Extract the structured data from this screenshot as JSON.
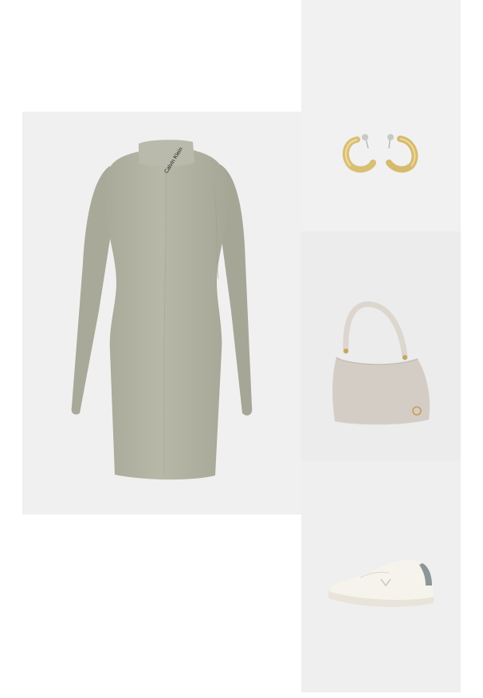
{
  "outfit": {
    "items": [
      {
        "id": "dress",
        "brand_print": "Calvin Klein",
        "color": "#b2b3a3"
      },
      {
        "id": "earrings",
        "color": "#d8bd74"
      },
      {
        "id": "shoulder-bag",
        "color": "#d3cdc6"
      },
      {
        "id": "sneaker",
        "color": "#f4f1ea"
      }
    ]
  }
}
